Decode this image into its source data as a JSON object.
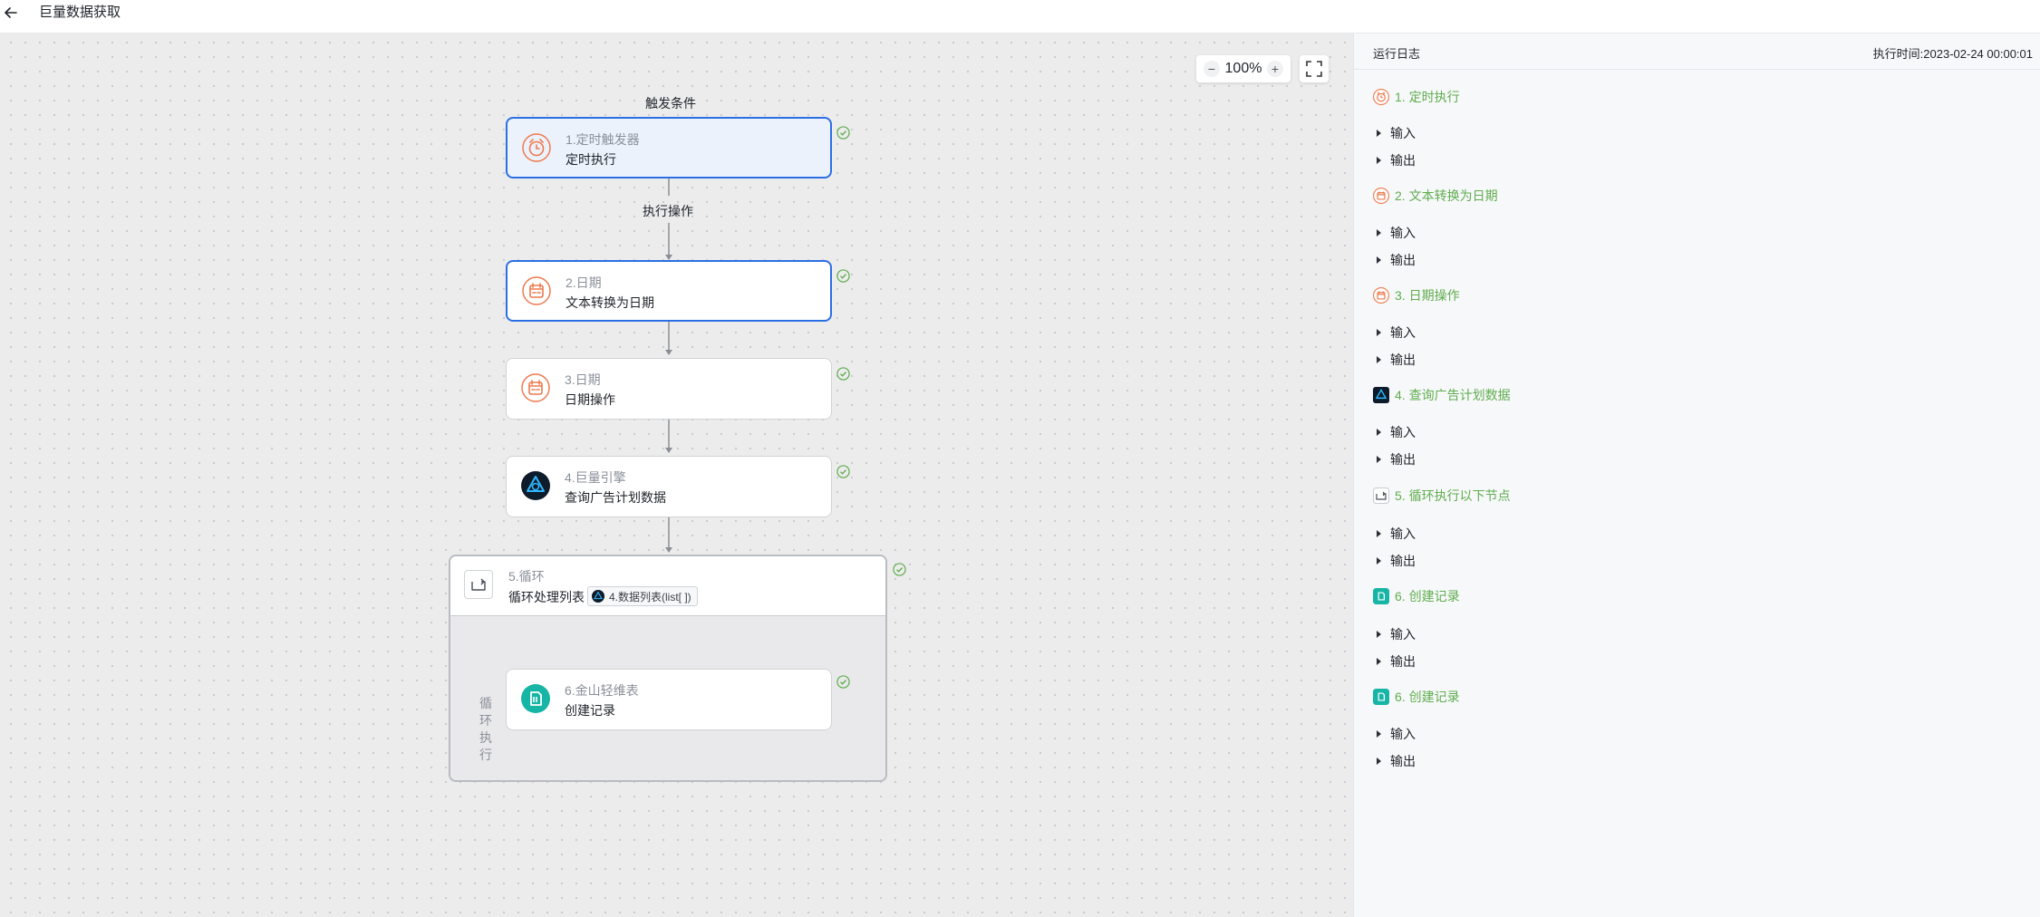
{
  "header": {
    "title": "巨量数据获取",
    "back_icon": "arrow-left-icon"
  },
  "canvas": {
    "zoom": {
      "minus": "−",
      "value": "100%",
      "plus": "+"
    },
    "trigger_label": "触发条件",
    "action_label": "执行操作",
    "nodes": [
      {
        "step": "1.定时触发器",
        "action": "定时执行",
        "icon": "alarm-clock-icon",
        "status": "success"
      },
      {
        "step": "2.日期",
        "action": "文本转换为日期",
        "icon": "calendar-icon",
        "status": "success"
      },
      {
        "step": "3.日期",
        "action": "日期操作",
        "icon": "calendar-icon",
        "status": "success"
      },
      {
        "step": "4.巨量引擎",
        "action": "查询广告计划数据",
        "icon": "ocean-engine-icon",
        "status": "success"
      },
      {
        "step": "6.金山轻维表",
        "action": "创建记录",
        "icon": "kingsoft-sheet-icon",
        "status": "success"
      }
    ],
    "loop": {
      "step": "5.循环",
      "action": "循环处理列表",
      "chip": "4.数据列表(list[ ])",
      "side_label": "循环执行",
      "status": "success"
    }
  },
  "panel": {
    "title": "运行日志",
    "exec_time": "执行时间:2023-02-24 00:00:01",
    "input_label": "输入",
    "output_label": "输出",
    "steps": [
      {
        "label": "1. 定时执行",
        "icon": "alarm-clock-icon"
      },
      {
        "label": "2. 文本转换为日期",
        "icon": "calendar-icon"
      },
      {
        "label": "3. 日期操作",
        "icon": "calendar-icon"
      },
      {
        "label": "4. 查询广告计划数据",
        "icon": "ocean-engine-icon"
      },
      {
        "label": "5. 循环执行以下节点",
        "icon": "loop-icon"
      },
      {
        "label": "6. 创建记录",
        "icon": "kingsoft-sheet-icon"
      },
      {
        "label": "6. 创建记录",
        "icon": "kingsoft-sheet-icon"
      }
    ]
  },
  "colors": {
    "accent": "#2b6fe5",
    "success": "#5fad4d",
    "orange": "#ee7a4e",
    "teal": "#17b5a5"
  }
}
